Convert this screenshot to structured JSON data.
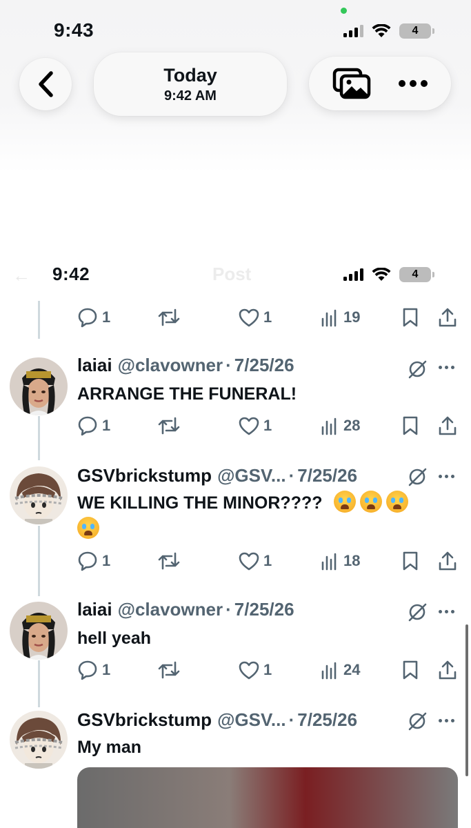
{
  "viewer": {
    "status_time": "9:43",
    "battery": "4",
    "date_title": "Today",
    "date_time": "9:42 AM"
  },
  "inner": {
    "status_time": "9:42",
    "battery": "4",
    "header_title": "Post"
  },
  "colors": {
    "accent": "#1d9bf0",
    "muted": "#536471",
    "thread_line": "#cfd9de"
  },
  "top_actions": {
    "replies": "1",
    "reposts": "",
    "likes": "1",
    "views": "19"
  },
  "tweets": [
    {
      "name": "laiai",
      "handle": "@clavowner",
      "sep": "·",
      "date": "7/25/26",
      "text": "ARRANGE THE FUNERAL!",
      "replies": "1",
      "likes": "1",
      "views": "28"
    },
    {
      "name": "GSVbrickstump",
      "handle": "@GSV...",
      "sep": "·",
      "date": "7/25/26",
      "text": "WE KILLING THE MINOR????",
      "emoji": "loudly-crying-face",
      "emoji_count": 4,
      "replies": "1",
      "likes": "1",
      "views": "18"
    },
    {
      "name": "laiai",
      "handle": "@clavowner",
      "sep": "·",
      "date": "7/25/26",
      "text": "hell yeah",
      "replies": "1",
      "likes": "1",
      "views": "24"
    },
    {
      "name": "GSVbrickstump",
      "handle": "@GSV...",
      "sep": "·",
      "date": "7/25/26",
      "text": "My man"
    }
  ]
}
